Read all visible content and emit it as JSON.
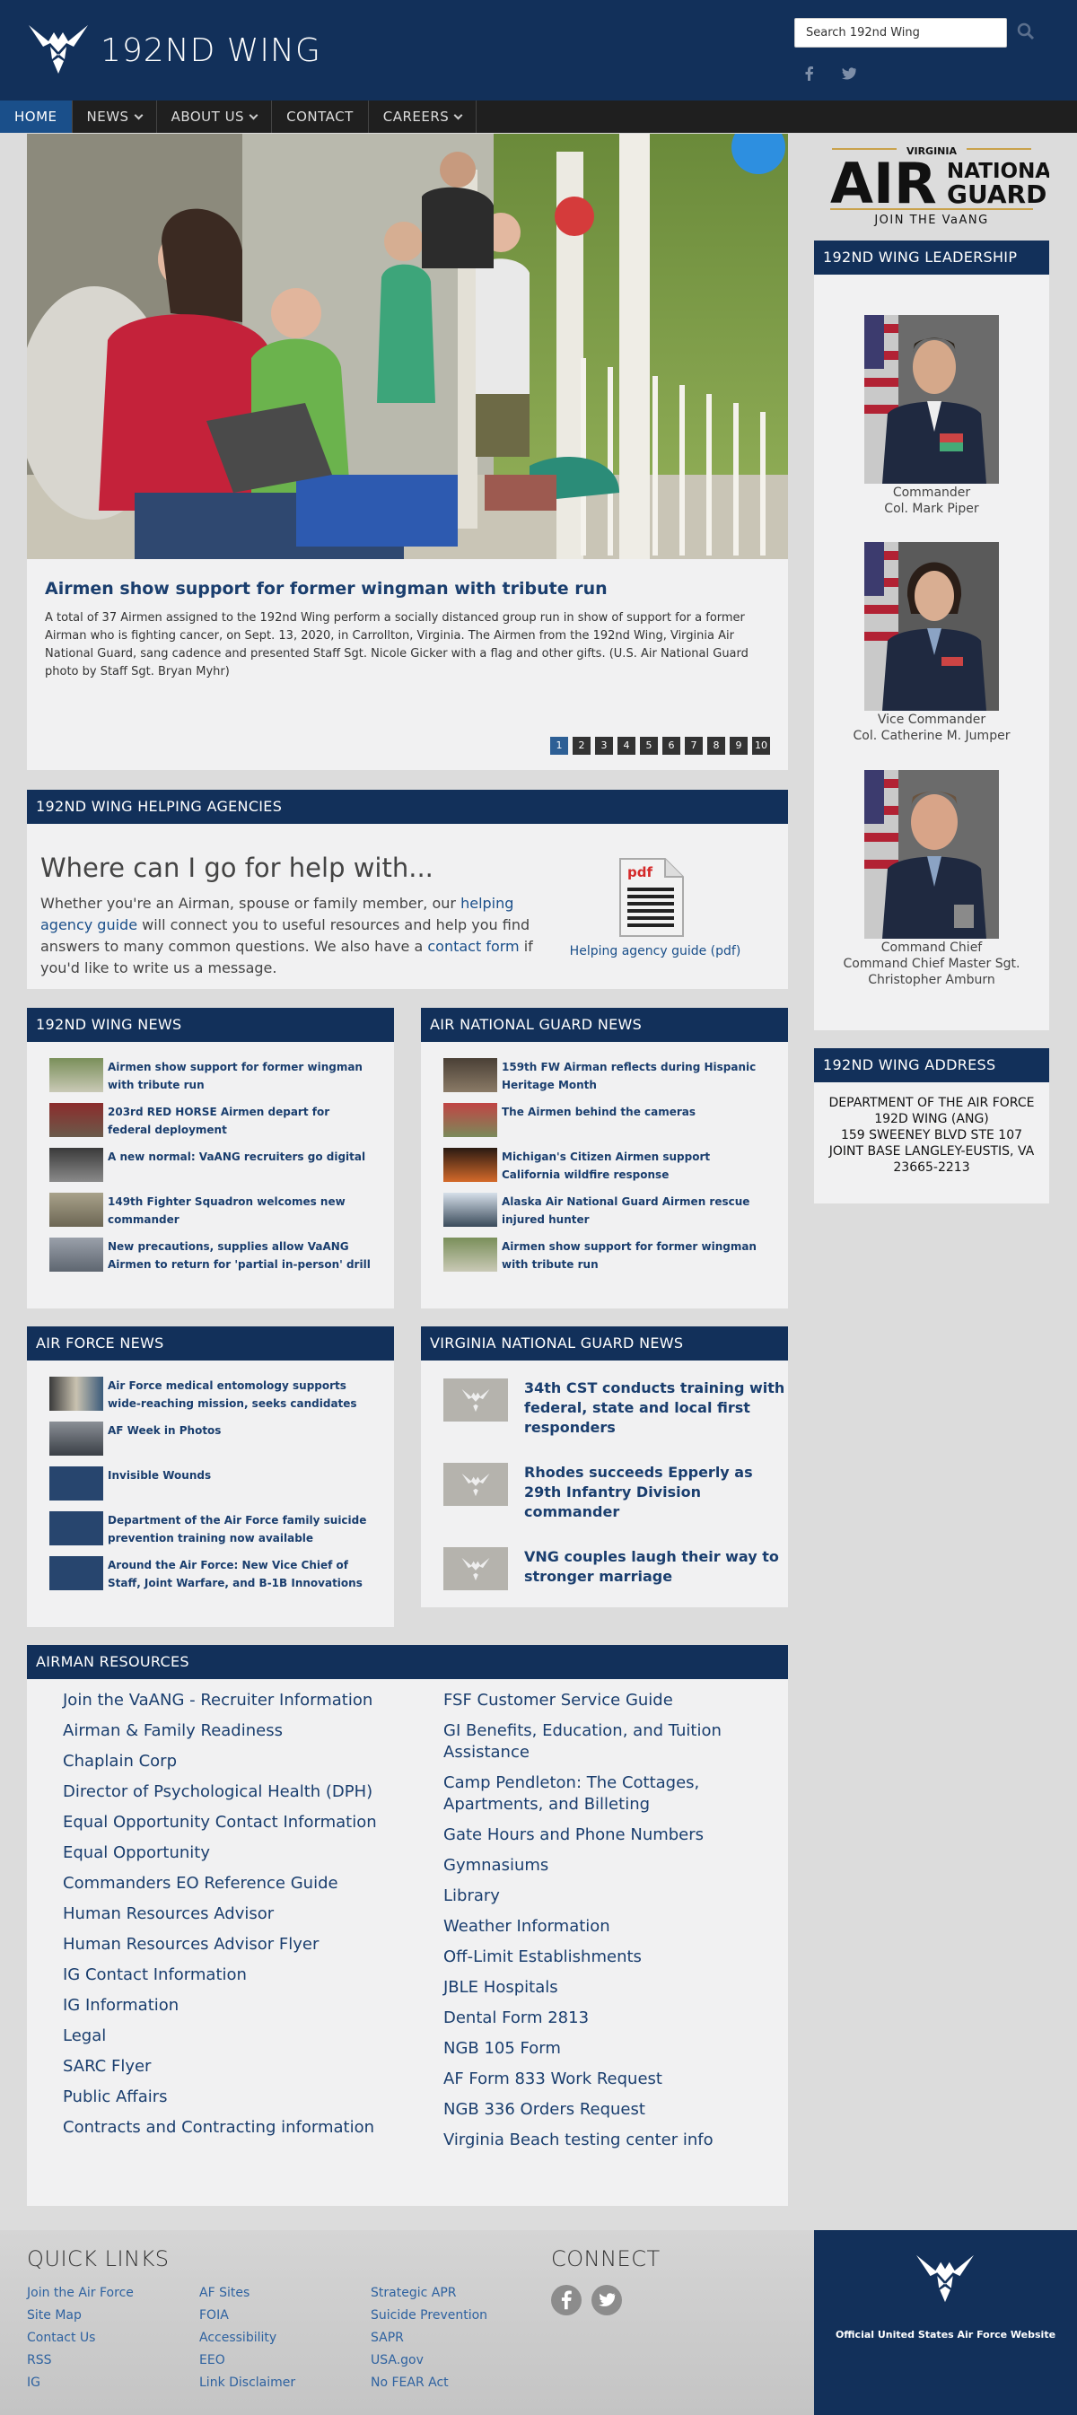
{
  "header": {
    "title": "192ND WING",
    "search_placeholder": "Search 192nd Wing"
  },
  "nav": [
    {
      "label": "HOME",
      "active": true,
      "dropdown": false
    },
    {
      "label": "NEWS",
      "active": false,
      "dropdown": true
    },
    {
      "label": "ABOUT US",
      "active": false,
      "dropdown": true
    },
    {
      "label": "CONTACT",
      "active": false,
      "dropdown": false
    },
    {
      "label": "CAREERS",
      "active": false,
      "dropdown": true
    }
  ],
  "hero": {
    "title": "Airmen show support for former wingman with tribute run",
    "text": "A total of 37 Airmen assigned to the 192nd Wing perform a socially distanced group run in show of support for a former Airman who is fighting cancer, on Sept. 13, 2020, in Carrollton, Virginia. The Airmen from the 192nd Wing, Virginia Air National Guard, sang cadence and presented Staff Sgt. Nicole Gicker with a flag and other gifts. (U.S. Air National Guard photo by Staff Sgt. Bryan Myhr)",
    "pages": [
      "1",
      "2",
      "3",
      "4",
      "5",
      "6",
      "7",
      "8",
      "9",
      "10"
    ],
    "active_page": "1"
  },
  "helping": {
    "heading": "192ND WING HELPING AGENCIES",
    "title": "Where can I go for help with...",
    "text_1": "Whether you're an Airman, spouse or family member, our ",
    "link_1": "helping agency guide",
    "text_2": " will connect you to useful resources and help you find answers to many common questions. We also have a ",
    "link_2": "contact form",
    "text_3": " if you'd like to write us a message.",
    "pdf_label": "pdf",
    "pdf_link": "Helping agency guide (pdf)"
  },
  "wing_news": {
    "heading": "192ND WING NEWS",
    "items": [
      "Airmen show support for former wingman with tribute run",
      "203rd RED HORSE Airmen depart for federal deployment",
      "A new normal: VaANG recruiters go digital",
      "149th Fighter Squadron welcomes new commander",
      "New precautions, supplies allow VaANG Airmen to return for 'partial in-person' drill"
    ]
  },
  "ang_news": {
    "heading": "AIR NATIONAL GUARD NEWS",
    "items": [
      "159th FW Airman reflects during Hispanic Heritage Month",
      "The Airmen behind the cameras",
      "Michigan's Citizen Airmen support California wildfire response",
      "Alaska Air National Guard Airmen rescue injured hunter",
      "Airmen show support for former wingman with tribute run"
    ]
  },
  "af_news": {
    "heading": "AIR FORCE NEWS",
    "items": [
      "Air Force medical entomology supports wide-reaching mission, seeks candidates",
      "AF Week in Photos",
      "Invisible Wounds",
      "Department of the Air Force family suicide prevention training now available",
      "Around the Air Force: New Vice Chief of Staff, Joint Warfare, and B-1B Innovations"
    ]
  },
  "vng_news": {
    "heading": "VIRGINIA NATIONAL GUARD NEWS",
    "items": [
      "34th CST conducts training with federal, state and local first responders",
      "Rhodes succeeds Epperly as 29th Infantry Division commander",
      "VNG couples laugh their way to stronger marriage"
    ]
  },
  "resources": {
    "heading": "AIRMAN RESOURCES",
    "left": [
      "Join the VaANG - Recruiter Information",
      "Airman & Family Readiness",
      "Chaplain Corp",
      "Director of Psychological Health (DPH)",
      "Equal Opportunity Contact Information",
      "Equal Opportunity",
      "Commanders EO Reference Guide",
      "Human Resources Advisor",
      "Human Resources Advisor Flyer",
      "IG Contact Information",
      "IG Information",
      "Legal",
      "SARC Flyer",
      "Public Affairs",
      "Contracts and Contracting information"
    ],
    "right": [
      "FSF Customer Service Guide",
      "GI Benefits, Education, and Tuition Assistance",
      "Camp Pendleton: The Cottages, Apartments, and Billeting",
      "Gate Hours and Phone Numbers",
      "Gymnasiums",
      "Library",
      "Weather Information",
      "Off-Limit Establishments",
      "JBLE Hospitals",
      "Dental Form 2813",
      "NGB 105 Form",
      "AF Form 833 Work Request",
      "NGB 336 Orders Request",
      "Virginia Beach testing center info"
    ]
  },
  "ang_logo": {
    "virginia": "VIRGINIA",
    "air": "AIR",
    "national": "NATIONAL",
    "guard": "GUARD",
    "tagline": "JOIN THE VaANG"
  },
  "leadership": {
    "heading": "192ND WING LEADERSHIP",
    "people": [
      {
        "role": "Commander",
        "name": "Col. Mark Piper"
      },
      {
        "role": "Vice Commander",
        "name": "Col. Catherine M. Jumper"
      },
      {
        "role": "Command Chief",
        "name": "Command Chief Master Sgt. Christopher Amburn"
      }
    ]
  },
  "address": {
    "heading": "192ND WING ADDRESS",
    "lines": [
      "DEPARTMENT OF THE AIR FORCE",
      "192D WING (ANG)",
      "159 SWEENEY BLVD STE 107",
      "JOINT BASE LANGLEY-EUSTIS, VA",
      "23665-2213"
    ]
  },
  "footer": {
    "quick_links_heading": "QUICK LINKS",
    "col1": [
      "Join the Air Force",
      "Site Map",
      "Contact Us",
      "RSS",
      "IG"
    ],
    "col2": [
      "AF Sites",
      "FOIA",
      "Accessibility",
      "EEO",
      "Link Disclaimer"
    ],
    "col3": [
      "Strategic APR",
      "Suicide Prevention",
      "SAPR",
      "USA.gov",
      "No FEAR Act"
    ],
    "connect_heading": "CONNECT",
    "af_site": "Official United States Air Force Website"
  },
  "colors": {
    "navy": "#12305a",
    "link": "#1a3e6e",
    "nav_bg": "#1f1f1f",
    "ang_gold": "#c9a24c"
  }
}
